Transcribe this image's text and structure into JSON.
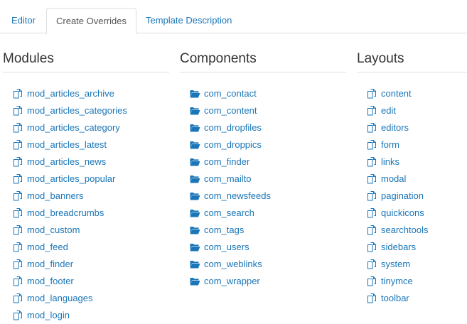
{
  "tabs": [
    {
      "label": "Editor",
      "active": false
    },
    {
      "label": "Create Overrides",
      "active": true
    },
    {
      "label": "Template Description",
      "active": false
    }
  ],
  "modules": {
    "title": "Modules",
    "icon": "file-copy-icon",
    "items": [
      "mod_articles_archive",
      "mod_articles_categories",
      "mod_articles_category",
      "mod_articles_latest",
      "mod_articles_news",
      "mod_articles_popular",
      "mod_banners",
      "mod_breadcrumbs",
      "mod_custom",
      "mod_feed",
      "mod_finder",
      "mod_footer",
      "mod_languages",
      "mod_login"
    ]
  },
  "components": {
    "title": "Components",
    "icon": "folder-open-icon",
    "items": [
      "com_contact",
      "com_content",
      "com_dropfiles",
      "com_droppics",
      "com_finder",
      "com_mailto",
      "com_newsfeeds",
      "com_search",
      "com_tags",
      "com_users",
      "com_weblinks",
      "com_wrapper"
    ]
  },
  "layouts": {
    "title": "Layouts",
    "icon": "file-copy-icon",
    "items": [
      "content",
      "edit",
      "editors",
      "form",
      "links",
      "modal",
      "pagination",
      "quickicons",
      "searchtools",
      "sidebars",
      "system",
      "tinymce",
      "toolbar"
    ]
  },
  "colors": {
    "link": "#1a76b8",
    "border": "#dddddd",
    "text": "#333333"
  }
}
